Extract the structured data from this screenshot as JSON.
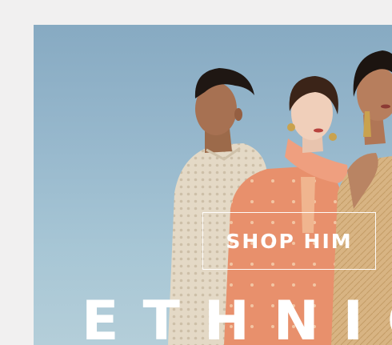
{
  "banner": {
    "cta_label": "SHOP HIM",
    "headline": "ETHNIC"
  },
  "colors": {
    "page_background": "#f1f0f0",
    "sky": "#9cbccf",
    "text": "#ffffff",
    "peach_outfit": "#e9926f",
    "ivory_kurta": "#e6dccb",
    "gold_outfit": "#d9b98b"
  }
}
